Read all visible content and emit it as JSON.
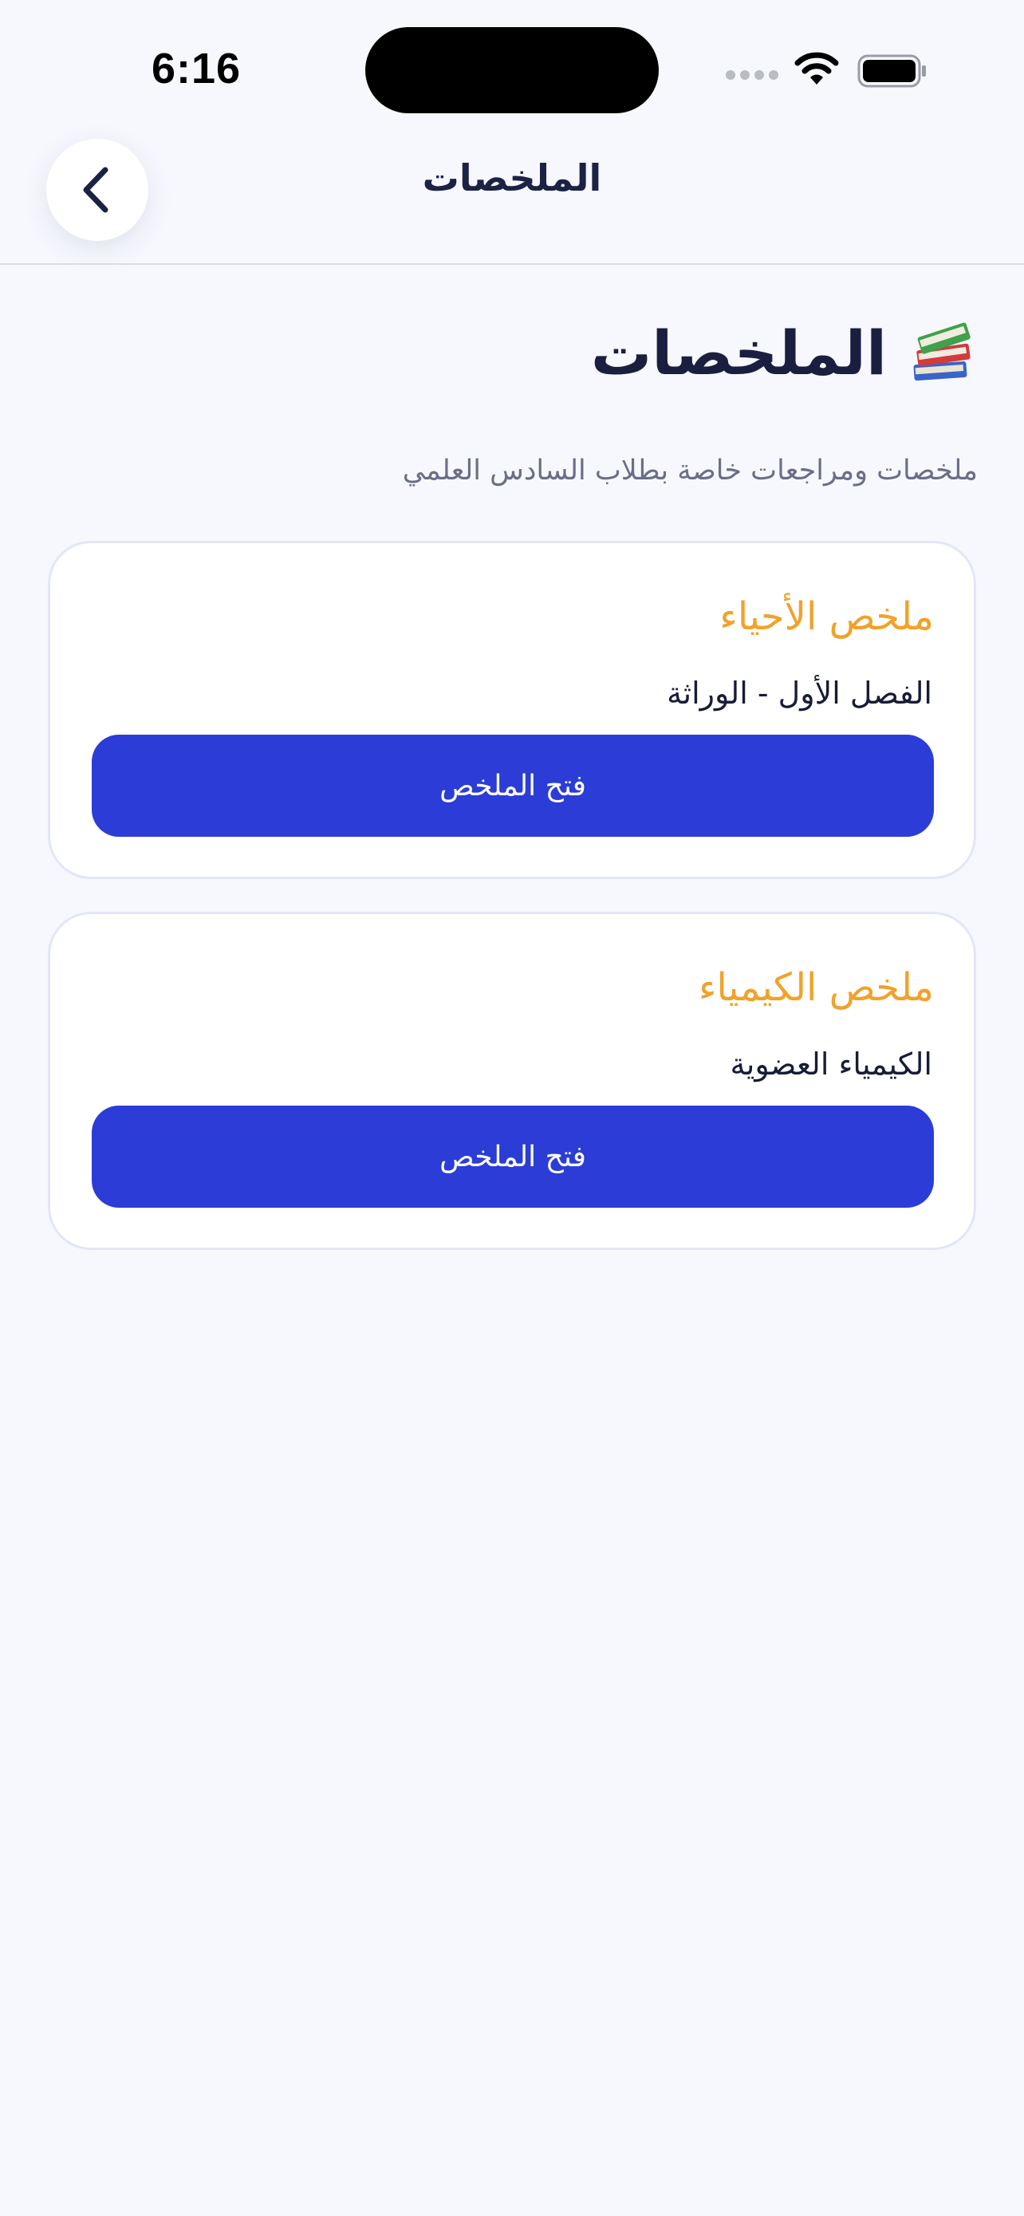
{
  "status_bar": {
    "time": "6:16",
    "icons": [
      "cellular-signal-icon",
      "wifi-icon",
      "battery-icon"
    ]
  },
  "nav": {
    "back_icon": "chevron-left-icon",
    "title": "الملخصات"
  },
  "header": {
    "icon": "books-icon",
    "title": "الملخصات",
    "subtitle": "ملخصات ومراجعات خاصة بطلاب السادس العلمي"
  },
  "cards": [
    {
      "title": "ملخص الأحياء",
      "subtitle": "الفصل الأول - الوراثة",
      "button_label": "فتح الملخص"
    },
    {
      "title": "ملخص الكيمياء",
      "subtitle": "الكيمياء العضوية",
      "button_label": "فتح الملخص"
    }
  ],
  "colors": {
    "background": "#f7f8fe",
    "accent": "#2b3dd6",
    "card_title": "#f1a22a",
    "text_dark": "#1a1f40"
  }
}
